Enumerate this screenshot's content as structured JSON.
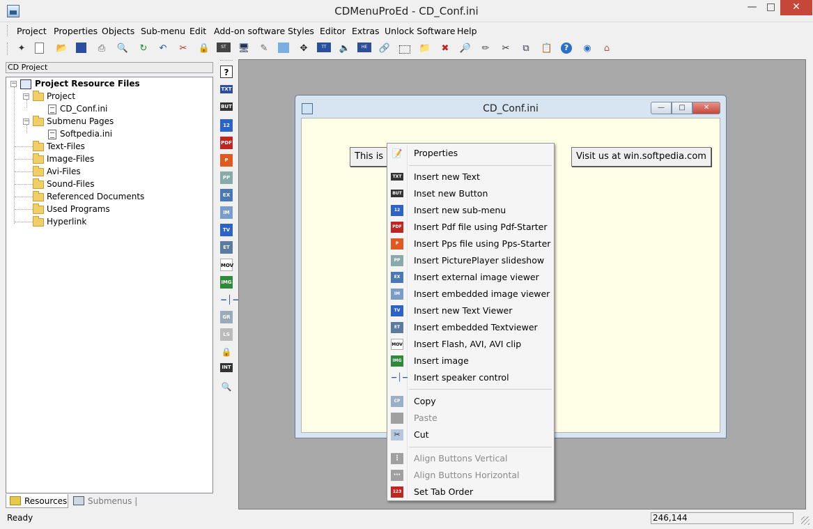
{
  "window": {
    "title": "CDMenuProEd - CD_Conf.ini"
  },
  "menu": [
    "Project",
    "Properties",
    "Objects",
    "Sub-menu",
    "Edit",
    "Add-on software",
    "Styles",
    "Editor",
    "Extras",
    "Unlock Software",
    "Help"
  ],
  "toolbar": {
    "icons": [
      "new-wand-icon",
      "new-file-icon",
      "open-folder-icon",
      "save-icon",
      "print-icon",
      "print-preview-icon",
      "refresh-icon",
      "undo-icon",
      "cut-red-icon",
      "lock-icon",
      "start-icon",
      "monitor-icon",
      "paint-icon",
      "picture-icon",
      "move-icon",
      "title-icon",
      "speaker-icon",
      "hello-icon",
      "link-icon",
      "frame-icon",
      "folder-star-icon",
      "image-x-icon",
      "search-image-icon",
      "brush-icon",
      "scissors-icon",
      "copy-icon",
      "paste-icon",
      "help-icon",
      "web-icon",
      "home-icon"
    ]
  },
  "left_panel": {
    "header": "CD Project",
    "tree": {
      "root": "Project Resource Files",
      "project_folder": "Project",
      "project_file": "CD_Conf.ini",
      "submenu_folder": "Submenu Pages",
      "submenu_file": "Softpedia.ini",
      "folders": [
        "Text-Files",
        "Image-Files",
        "Avi-Files",
        "Sound-Files",
        "Referenced Documents",
        "Used Programs",
        "Hyperlink"
      ]
    },
    "tabs": {
      "resources": "Resources",
      "submenus": "Submenus"
    }
  },
  "inner_window": {
    "title": "CD_Conf.ini",
    "button_left": "This is a",
    "button_right": "Visit us at win.softpedia.com"
  },
  "context_menu": {
    "properties": "Properties",
    "insert_items": [
      "Insert new Text",
      "Inset new Button",
      "Insert new sub-menu",
      "Insert Pdf file using Pdf-Starter",
      "Insert Pps file using Pps-Starter",
      "Insert PicturePlayer slideshow",
      "Insert external image viewer",
      "Insert embedded image viewer",
      "Insert new Text Viewer",
      "Insert embedded Textviewer",
      "Insert Flash, AVI, AVI clip",
      "Insert image",
      "Insert speaker control"
    ],
    "copy": "Copy",
    "paste": "Paste",
    "cut": "Cut",
    "align_vertical": "Align Buttons Vertical",
    "align_horizontal": "Align Buttons Horizontal",
    "tab_order": "Set Tab Order"
  },
  "status": {
    "text": "Ready",
    "coords": "246,144"
  },
  "colors": {
    "workspace": "#a9a9a9",
    "canvas": "#fffee7",
    "close_red": "#c7463a"
  }
}
